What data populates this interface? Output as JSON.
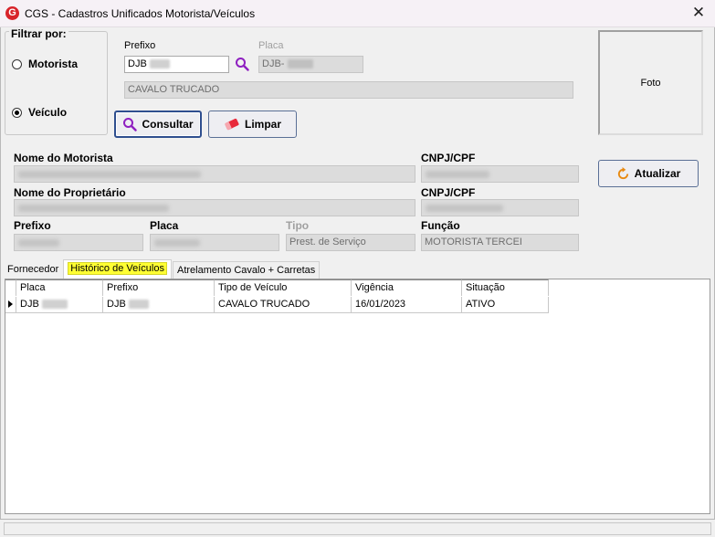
{
  "window": {
    "title": "CGS - Cadastros Unificados Motorista/Veículos",
    "close_glyph": "✕",
    "app_icon_letter": "G",
    "accent": "#d8232a"
  },
  "filter": {
    "legend": "Filtrar por:",
    "options": [
      {
        "label": "Motorista",
        "checked": false
      },
      {
        "label": "Veículo",
        "checked": true
      }
    ]
  },
  "search": {
    "prefixo_label": "Prefixo",
    "prefixo_value": "DJB",
    "placa_label": "Placa",
    "placa_value": "DJB-",
    "description_value": "CAVALO TRUCADO",
    "consultar_label": "Consultar",
    "limpar_label": "Limpar"
  },
  "photo": {
    "label": "Foto"
  },
  "details": {
    "motorista_label": "Nome do Motorista",
    "cnpj_label_1": "CNPJ/CPF",
    "proprietario_label": "Nome do Proprietário",
    "cnpj_label_2": "CNPJ/CPF",
    "prefixo_label": "Prefixo",
    "placa_label": "Placa",
    "tipo_label": "Tipo",
    "tipo_value": "Prest. de Serviço",
    "funcao_label": "Função",
    "funcao_value": "MOTORISTA TERCEI",
    "atualizar_label": "Atualizar"
  },
  "tabs": [
    {
      "label": "Fornecedor",
      "active": false
    },
    {
      "label": "Histórico de Veículos",
      "active": true
    },
    {
      "label": "Atrelamento Cavalo + Carretas",
      "active": false
    }
  ],
  "grid": {
    "columns": [
      "Placa",
      "Prefixo",
      "Tipo de Veículo",
      "Vigência",
      "Situação"
    ],
    "rows": [
      [
        "DJB",
        "DJB",
        "CAVALO TRUCADO",
        "16/01/2023",
        "ATIVO"
      ]
    ]
  }
}
